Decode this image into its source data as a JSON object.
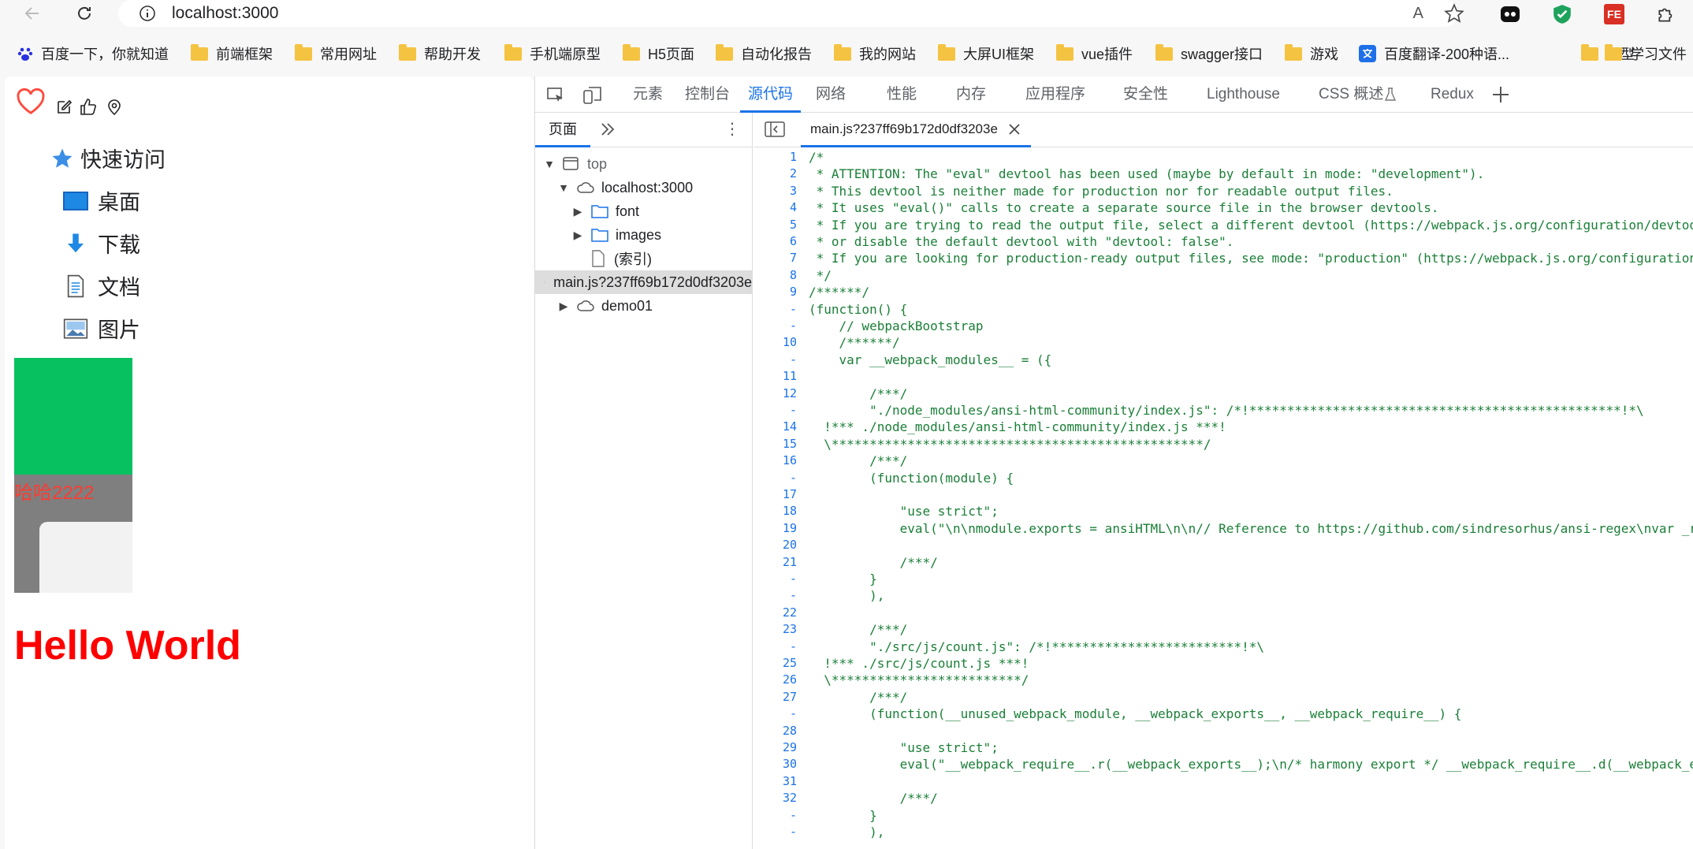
{
  "browser": {
    "url": "localhost:3000",
    "read_aloud": "A",
    "bookmarks": [
      {
        "label": "百度一下，你就知道",
        "icon": "baidu-paw-icon"
      },
      {
        "label": "前端框架",
        "icon": "folder-icon"
      },
      {
        "label": "常用网址",
        "icon": "folder-icon"
      },
      {
        "label": "帮助开发",
        "icon": "folder-icon"
      },
      {
        "label": "手机端原型",
        "icon": "folder-icon"
      },
      {
        "label": "H5页面",
        "icon": "folder-icon"
      },
      {
        "label": "自动化报告",
        "icon": "folder-icon"
      },
      {
        "label": "我的网站",
        "icon": "folder-icon"
      },
      {
        "label": "大屏UI框架",
        "icon": "folder-icon"
      },
      {
        "label": "vue插件",
        "icon": "folder-icon"
      },
      {
        "label": "swagger接口",
        "icon": "folder-icon"
      },
      {
        "label": "游戏",
        "icon": "folder-icon"
      },
      {
        "label": "百度翻译-200种语...",
        "icon": "translate-icon"
      },
      {
        "label": "原型",
        "icon": "folder-icon"
      },
      {
        "label": "学习文件",
        "icon": "folder-icon"
      }
    ],
    "extensions": [
      {
        "name": "eye-extension-icon",
        "label": ""
      },
      {
        "name": "shield-extension-icon",
        "label": ""
      },
      {
        "name": "fe-extension-icon",
        "label": "FE"
      },
      {
        "name": "puzzle-extension-icon",
        "label": ""
      }
    ]
  },
  "page": {
    "quick_access": "快速访问",
    "items": [
      "桌面",
      "下载",
      "文档",
      "图片"
    ],
    "overlay_text": "哈哈2222",
    "hello": "Hello World",
    "colors": {
      "green": "#07c160",
      "hello": "#ff0000"
    }
  },
  "devtools": {
    "tabs": [
      "元素",
      "控制台",
      "源代码",
      "网络",
      "性能",
      "内存",
      "应用程序",
      "安全性",
      "Lighthouse",
      "CSS 概述",
      "Redux"
    ],
    "active_tab": "源代码",
    "left_tabs": {
      "page": "页面"
    },
    "tree": [
      {
        "label": "top",
        "icon": "window-icon",
        "level": 0,
        "arrow": "▼"
      },
      {
        "label": "localhost:3000",
        "icon": "cloud-icon",
        "level": 1,
        "arrow": "▼"
      },
      {
        "label": "font",
        "icon": "folder-outline-icon",
        "level": 2,
        "arrow": "▶"
      },
      {
        "label": "images",
        "icon": "folder-outline-icon",
        "level": 2,
        "arrow": "▶"
      },
      {
        "label": "(索引)",
        "icon": "file-icon",
        "level": 2,
        "arrow": ""
      },
      {
        "label": "main.js?237ff69b172d0df3203e",
        "icon": "js-file-icon",
        "level": 2,
        "arrow": "",
        "selected": true
      },
      {
        "label": "demo01",
        "icon": "cloud-icon",
        "level": 1,
        "arrow": "▶"
      }
    ],
    "open_file": "main.js?237ff69b172d0df3203e",
    "code": [
      {
        "n": "1",
        "t": "/*"
      },
      {
        "n": "2",
        "t": " * ATTENTION: The \"eval\" devtool has been used (maybe by default in mode: \"development\")."
      },
      {
        "n": "3",
        "t": " * This devtool is neither made for production nor for readable output files."
      },
      {
        "n": "4",
        "t": " * It uses \"eval()\" calls to create a separate source file in the browser devtools."
      },
      {
        "n": "5",
        "t": " * If you are trying to read the output file, select a different devtool (https://webpack.js.org/configuration/devtool/)"
      },
      {
        "n": "6",
        "t": " * or disable the default devtool with \"devtool: false\"."
      },
      {
        "n": "7",
        "t": " * If you are looking for production-ready output files, see mode: \"production\" (https://webpack.js.org/configuration/mode/)."
      },
      {
        "n": "8",
        "t": " */"
      },
      {
        "n": "9",
        "t": "/******/"
      },
      {
        "n": "-",
        "t": "(function() {"
      },
      {
        "n": "-",
        "t": "    // webpackBootstrap"
      },
      {
        "n": "10",
        "t": "    /******/"
      },
      {
        "n": "-",
        "t": "    var __webpack_modules__ = ({"
      },
      {
        "n": "11",
        "t": ""
      },
      {
        "n": "12",
        "t": "        /***/"
      },
      {
        "n": "-",
        "t": "        \"./node_modules/ansi-html-community/index.js\": /*!*************************************************!*\\"
      },
      {
        "n": "14",
        "t": "  !*** ./node_modules/ansi-html-community/index.js ***!"
      },
      {
        "n": "15",
        "t": "  \\*************************************************/"
      },
      {
        "n": "16",
        "t": "        /***/"
      },
      {
        "n": "-",
        "t": "        (function(module) {"
      },
      {
        "n": "17",
        "t": ""
      },
      {
        "n": "18",
        "t": "            \"use strict\";"
      },
      {
        "n": "19",
        "t": "            eval(\"\\n\\nmodule.exports = ansiHTML\\n\\n// Reference to https://github.com/sindresorhus/ansi-regex\\nvar _regANSI"
      },
      {
        "n": "20",
        "t": ""
      },
      {
        "n": "21",
        "t": "            /***/"
      },
      {
        "n": "-",
        "t": "        }"
      },
      {
        "n": "-",
        "t": "        ),"
      },
      {
        "n": "22",
        "t": ""
      },
      {
        "n": "23",
        "t": "        /***/"
      },
      {
        "n": "-",
        "t": "        \"./src/js/count.js\": /*!*************************!*\\"
      },
      {
        "n": "25",
        "t": "  !*** ./src/js/count.js ***!"
      },
      {
        "n": "26",
        "t": "  \\*************************/"
      },
      {
        "n": "27",
        "t": "        /***/"
      },
      {
        "n": "-",
        "t": "        (function(__unused_webpack_module, __webpack_exports__, __webpack_require__) {"
      },
      {
        "n": "28",
        "t": ""
      },
      {
        "n": "29",
        "t": "            \"use strict\";"
      },
      {
        "n": "30",
        "t": "            eval(\"__webpack_require__.r(__webpack_exports__);\\n/* harmony export */ __webpack_require__.d(__webpack_exports__"
      },
      {
        "n": "31",
        "t": ""
      },
      {
        "n": "32",
        "t": "            /***/"
      },
      {
        "n": "-",
        "t": "        }"
      },
      {
        "n": "-",
        "t": "        ),"
      }
    ]
  }
}
